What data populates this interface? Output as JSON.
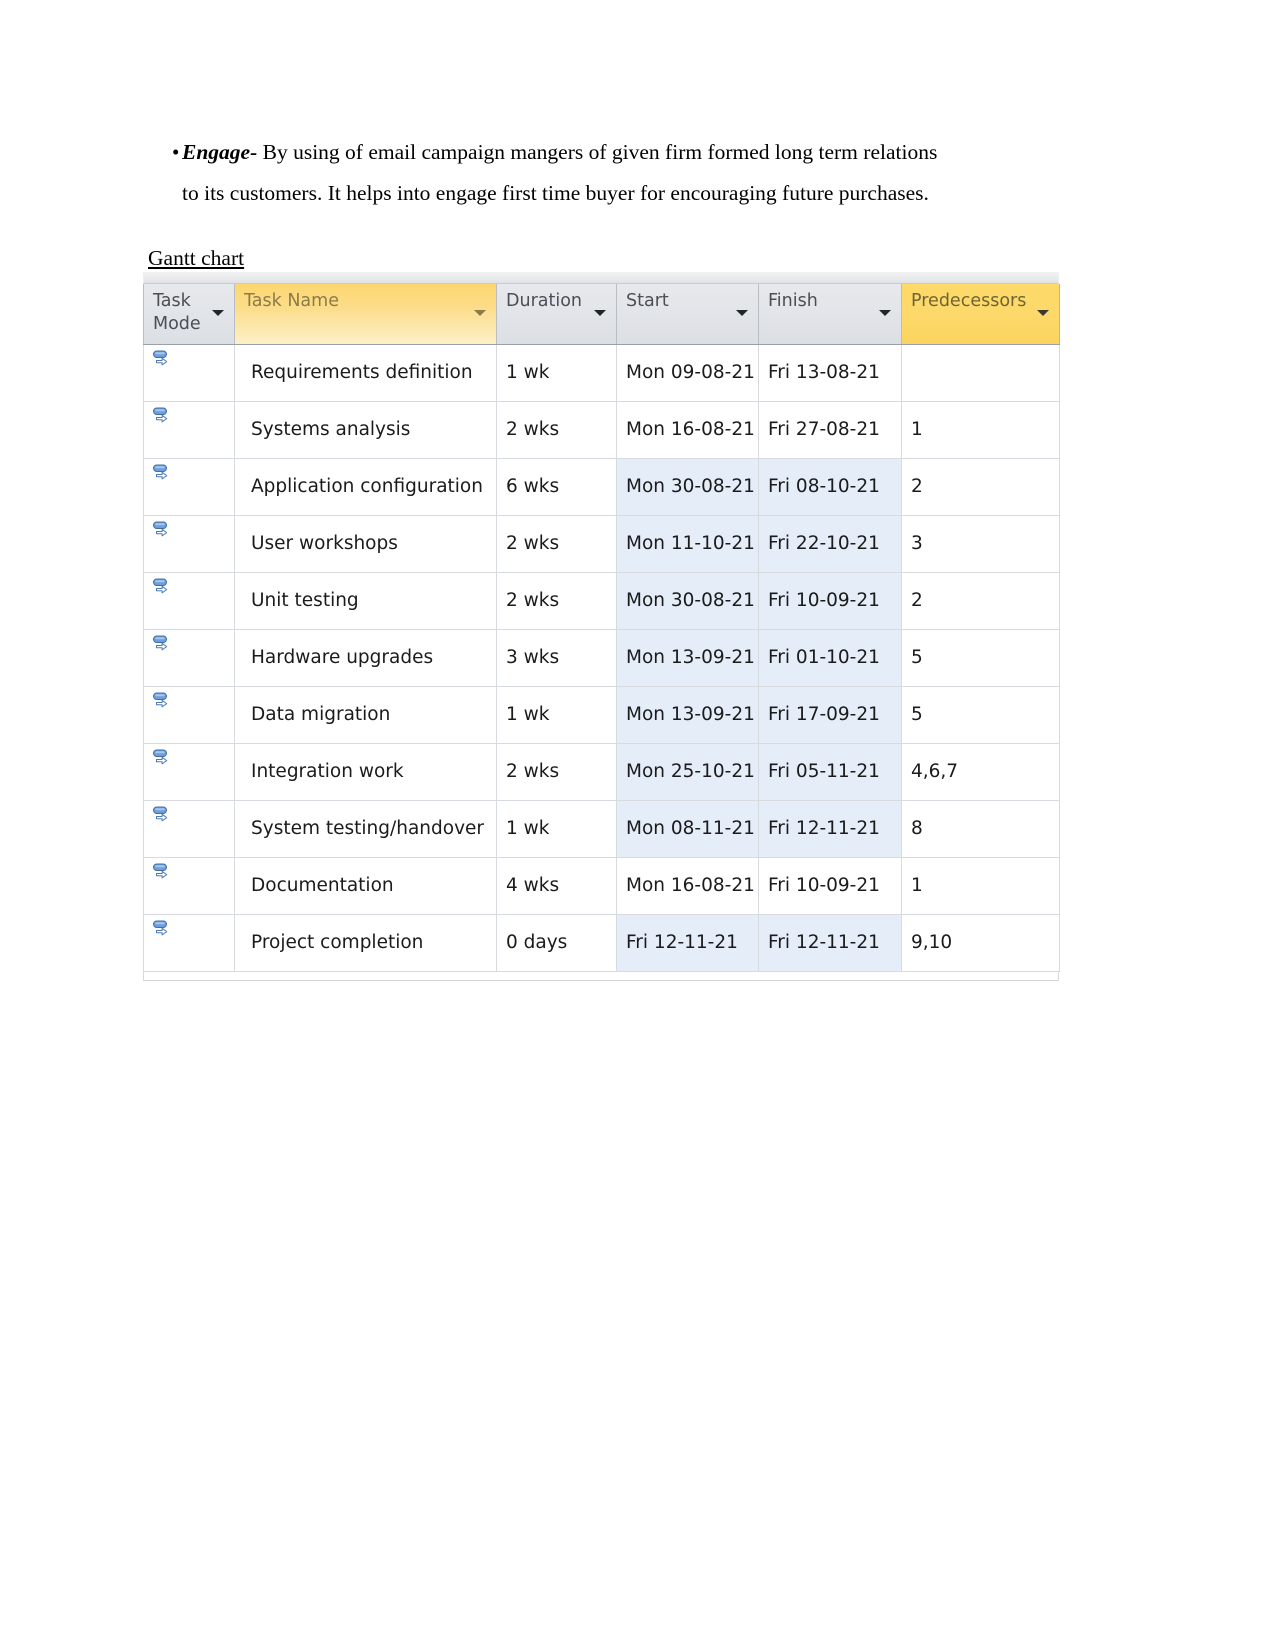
{
  "document": {
    "bullet_marker": "•",
    "bullet_lead": "Engage-",
    "bullet_text_line1": " By using of email campaign mangers of given firm formed long term relations",
    "bullet_text_line2": "to its customers. It helps into engage first time buyer for encouraging  future purchases.",
    "section_heading": "Gantt chart"
  },
  "grid": {
    "columns": [
      {
        "key": "mode",
        "label": "Task Mode",
        "style": "gray",
        "has_caret": true
      },
      {
        "key": "name",
        "label": "Task Name",
        "style": "yellow-grad",
        "has_caret": true
      },
      {
        "key": "dur",
        "label": "Duration",
        "style": "gray",
        "has_caret": true
      },
      {
        "key": "start",
        "label": "Start",
        "style": "gray",
        "has_caret": true
      },
      {
        "key": "finish",
        "label": "Finish",
        "style": "gray",
        "has_caret": true
      },
      {
        "key": "pred",
        "label": "Predecessors",
        "style": "yellow-solid",
        "has_caret": true
      }
    ],
    "header_labels": {
      "mode_line1": "Task",
      "mode_line2": "Mode",
      "name": "Task Name",
      "duration": "Duration",
      "start": "Start",
      "finish": "Finish",
      "predecessors": "Predecessors"
    },
    "task_mode_icon": "manually-scheduled-pin-icon",
    "colors": {
      "header_yellow": "#fcd968",
      "header_gray": "#e2e5e9",
      "row_highlight": "#e4edf8",
      "grid_line": "#d7dade"
    },
    "rows": [
      {
        "mode_icon": "manually-scheduled-pin-icon",
        "name": "Requirements definition",
        "duration": "1 wk",
        "start": "Mon 09-08-21",
        "finish": "Fri 13-08-21",
        "predecessors": "",
        "highlight": false
      },
      {
        "mode_icon": "manually-scheduled-pin-icon",
        "name": "Systems analysis",
        "duration": "2 wks",
        "start": "Mon 16-08-21",
        "finish": "Fri 27-08-21",
        "predecessors": "1",
        "highlight": false
      },
      {
        "mode_icon": "manually-scheduled-pin-icon",
        "name": "Application configuration",
        "duration": "6 wks",
        "start": "Mon 30-08-21",
        "finish": "Fri 08-10-21",
        "predecessors": "2",
        "highlight": true
      },
      {
        "mode_icon": "manually-scheduled-pin-icon",
        "name": "User workshops",
        "duration": "2 wks",
        "start": "Mon 11-10-21",
        "finish": "Fri 22-10-21",
        "predecessors": "3",
        "highlight": true
      },
      {
        "mode_icon": "manually-scheduled-pin-icon",
        "name": "Unit testing",
        "duration": "2 wks",
        "start": "Mon 30-08-21",
        "finish": "Fri 10-09-21",
        "predecessors": "2",
        "highlight": true
      },
      {
        "mode_icon": "manually-scheduled-pin-icon",
        "name": "Hardware upgrades",
        "duration": "3 wks",
        "start": "Mon 13-09-21",
        "finish": "Fri 01-10-21",
        "predecessors": "5",
        "highlight": true
      },
      {
        "mode_icon": "manually-scheduled-pin-icon",
        "name": "Data migration",
        "duration": "1 wk",
        "start": "Mon 13-09-21",
        "finish": "Fri 17-09-21",
        "predecessors": "5",
        "highlight": true
      },
      {
        "mode_icon": "manually-scheduled-pin-icon",
        "name": "Integration work",
        "duration": "2 wks",
        "start": "Mon 25-10-21",
        "finish": "Fri 05-11-21",
        "predecessors": "4,6,7",
        "highlight": true
      },
      {
        "mode_icon": "manually-scheduled-pin-icon",
        "name": "System testing/handover",
        "duration": "1 wk",
        "start": "Mon 08-11-21",
        "finish": "Fri 12-11-21",
        "predecessors": "8",
        "highlight": true
      },
      {
        "mode_icon": "manually-scheduled-pin-icon",
        "name": "Documentation",
        "duration": "4 wks",
        "start": "Mon 16-08-21",
        "finish": "Fri 10-09-21",
        "predecessors": "1",
        "highlight": false
      },
      {
        "mode_icon": "manually-scheduled-pin-icon",
        "name": "Project completion",
        "duration": "0 days",
        "start": "Fri 12-11-21",
        "finish": "Fri 12-11-21",
        "predecessors": "9,10",
        "highlight": true
      }
    ]
  }
}
